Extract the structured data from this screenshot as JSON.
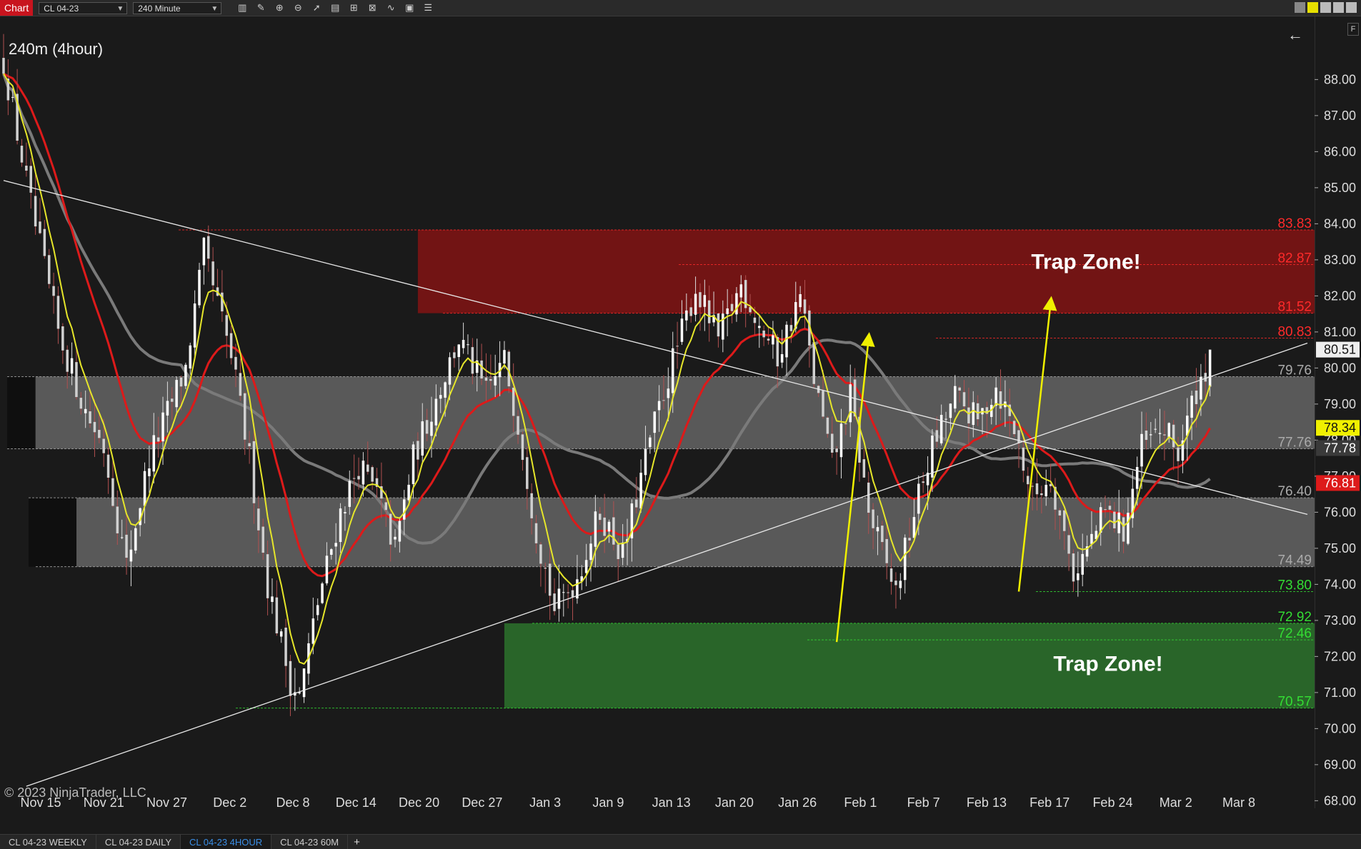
{
  "toolbar": {
    "chart_tab": "Chart",
    "instrument": "CL 04-23",
    "interval": "240 Minute",
    "icons": [
      "bar-type-icon",
      "draw-icon",
      "zoom-in-icon",
      "zoom-out-icon",
      "cursor-icon",
      "data-box-icon",
      "properties-icon",
      "strategies-icon",
      "indicators-icon",
      "templates-icon",
      "list-icon"
    ]
  },
  "chart_title": "240m (4hour)",
  "copyright": "© 2023 NinjaTrader, LLC",
  "annotations": {
    "trap_zone_upper": "Trap Zone!",
    "trap_zone_lower": "Trap Zone!"
  },
  "bottom_tabs": [
    "CL 04-23 WEEKLY",
    "CL 04-23 DAILY",
    "CL 04-23 4HOUR",
    "CL 04-23 60M"
  ],
  "active_tab": 2,
  "colors": {
    "background": "#1a1a1a",
    "up_candle": "#ffffff",
    "down_candle": "#d0d0d0",
    "ema_fast": "#e6e62a",
    "ema_mid": "#dd1a1a",
    "sma_slow": "#7a7a7a",
    "red_zone": "#7a1414",
    "green_zone": "#2a6b2a",
    "gray_zone": "#5e5e5e"
  },
  "chart_data": {
    "type": "candlestick",
    "instrument": "CL 04-23",
    "interval": "240 Minute",
    "ylim": [
      67.75,
      89.75
    ],
    "y_ticks": [
      68,
      69,
      70,
      71,
      72,
      73,
      74,
      75,
      76,
      77,
      78,
      79,
      80,
      81,
      82,
      83,
      84,
      85,
      86,
      87,
      88
    ],
    "x_tick_labels": [
      "Nov 15",
      "Nov 21",
      "Nov 27",
      "Dec 2",
      "Dec 8",
      "Dec 14",
      "Dec 20",
      "Dec 27",
      "Jan 3",
      "Jan 9",
      "Jan 13",
      "Jan 20",
      "Jan 26",
      "Feb 1",
      "Feb 7",
      "Feb 13",
      "Feb 17",
      "Feb 24",
      "Mar 2",
      "Mar 8"
    ],
    "bars": 250,
    "key_price_path": [
      [
        0,
        88.5
      ],
      [
        6,
        84.5
      ],
      [
        12,
        81.0
      ],
      [
        18,
        78.8
      ],
      [
        22,
        77.8
      ],
      [
        27,
        74.5
      ],
      [
        32,
        77.5
      ],
      [
        40,
        80.0
      ],
      [
        44,
        83.2
      ],
      [
        50,
        80.3
      ],
      [
        54,
        77.5
      ],
      [
        58,
        74.0
      ],
      [
        63,
        71.3
      ],
      [
        65,
        70.9
      ],
      [
        69,
        73.5
      ],
      [
        74,
        76.0
      ],
      [
        78,
        77.3
      ],
      [
        82,
        76.5
      ],
      [
        86,
        75.0
      ],
      [
        90,
        77.5
      ],
      [
        96,
        79.5
      ],
      [
        100,
        80.8
      ],
      [
        106,
        79.3
      ],
      [
        110,
        80.2
      ],
      [
        113,
        78.5
      ],
      [
        117,
        75.5
      ],
      [
        121,
        73.3
      ],
      [
        126,
        74.2
      ],
      [
        131,
        76.0
      ],
      [
        136,
        74.8
      ],
      [
        142,
        78.0
      ],
      [
        147,
        80.2
      ],
      [
        152,
        82.2
      ],
      [
        157,
        80.8
      ],
      [
        162,
        82.3
      ],
      [
        166,
        81.2
      ],
      [
        170,
        80.3
      ],
      [
        175,
        82.0
      ],
      [
        178,
        79.7
      ],
      [
        182,
        77.3
      ],
      [
        186,
        79.2
      ],
      [
        190,
        76.0
      ],
      [
        194,
        74.5
      ],
      [
        196,
        73.8
      ],
      [
        200,
        76.0
      ],
      [
        204,
        77.8
      ],
      [
        209,
        79.2
      ],
      [
        214,
        78.5
      ],
      [
        218,
        79.5
      ],
      [
        222,
        78.3
      ],
      [
        226,
        76.4
      ],
      [
        230,
        77.0
      ],
      [
        235,
        74.3
      ],
      [
        238,
        75.0
      ],
      [
        242,
        76.0
      ],
      [
        246,
        75.5
      ],
      [
        250,
        77.8
      ],
      [
        255,
        78.3
      ],
      [
        258,
        77.6
      ],
      [
        262,
        79.4
      ],
      [
        266,
        80.51
      ]
    ],
    "last_price": 80.51,
    "indicator_values": {
      "ema_fast": 78.34,
      "sma_slow": 77.78,
      "ema_mid": 76.81
    },
    "levels": [
      {
        "value": 83.83,
        "label": "83.83",
        "color": "#ff2a2a"
      },
      {
        "value": 82.87,
        "label": "82.87",
        "color": "#ff2a2a"
      },
      {
        "value": 81.52,
        "label": "81.52",
        "color": "#ff2a2a"
      },
      {
        "value": 80.83,
        "label": "80.83",
        "color": "#ff2a2a"
      },
      {
        "value": 79.76,
        "label": "79.76",
        "color": "#aaaaaa"
      },
      {
        "value": 77.76,
        "label": "77.76",
        "color": "#aaaaaa"
      },
      {
        "value": 76.4,
        "label": "76.40",
        "color": "#aaaaaa"
      },
      {
        "value": 74.49,
        "label": "74.49",
        "color": "#aaaaaa"
      },
      {
        "value": 73.8,
        "label": "73.80",
        "color": "#33dd33"
      },
      {
        "value": 72.92,
        "label": "72.92",
        "color": "#33dd33"
      },
      {
        "value": 72.46,
        "label": "72.46",
        "color": "#33dd33"
      },
      {
        "value": 70.57,
        "label": "70.57",
        "color": "#33dd33"
      }
    ],
    "zones": [
      {
        "name": "upper-trap-zone",
        "from": 81.52,
        "to": 83.83,
        "color": "#7a1414",
        "start_bar": 91
      },
      {
        "name": "upper-gray-zone",
        "from": 77.76,
        "to": 79.76,
        "color": "#5e5e5e",
        "start_bar": 7
      },
      {
        "name": "lower-gray-zone",
        "from": 74.49,
        "to": 76.4,
        "color": "#5e5e5e",
        "start_bar": 16
      },
      {
        "name": "lower-trap-zone",
        "from": 70.57,
        "to": 72.92,
        "color": "#2a6b2a",
        "start_bar": 110
      }
    ],
    "trendlines": [
      {
        "from": [
          0,
          85.2
        ],
        "to": [
          266,
          76.6
        ]
      },
      {
        "from": [
          5,
          68.4
        ],
        "to": [
          266,
          79.8
        ]
      }
    ],
    "arrows": [
      {
        "from": [
          183,
          72.4
        ],
        "to": [
          190,
          80.8
        ]
      },
      {
        "from": [
          223,
          73.8
        ],
        "to": [
          230,
          81.8
        ]
      }
    ]
  }
}
